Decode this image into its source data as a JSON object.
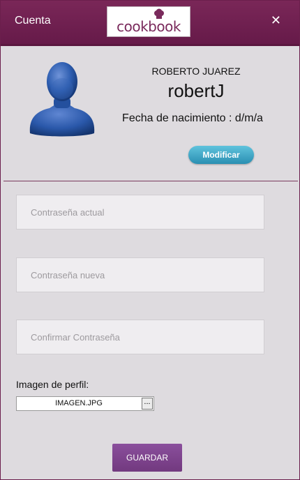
{
  "window": {
    "title": "Cuenta",
    "logo_text": "cookbook"
  },
  "profile": {
    "full_name": "ROBERTO JUAREZ",
    "username": "robertJ",
    "birth_date": "Fecha de nacimiento : d/m/a",
    "modify_label": "Modificar"
  },
  "form": {
    "current_password_placeholder": "Contraseña actual",
    "new_password_placeholder": "Contraseña nueva",
    "confirm_password_placeholder": "Confirmar Contraseña",
    "image_label": "Imagen de perfil:",
    "image_file": "IMAGEN.JPG",
    "browse_label": "...",
    "save_label": "GUARDAR"
  },
  "colors": {
    "brand": "#6b1f4c",
    "accent_button": "#2a8fb2",
    "save_button": "#7a4187"
  },
  "icons": {
    "close": "close-icon",
    "avatar": "user-avatar-icon",
    "logo_hat": "chef-hat-icon"
  }
}
